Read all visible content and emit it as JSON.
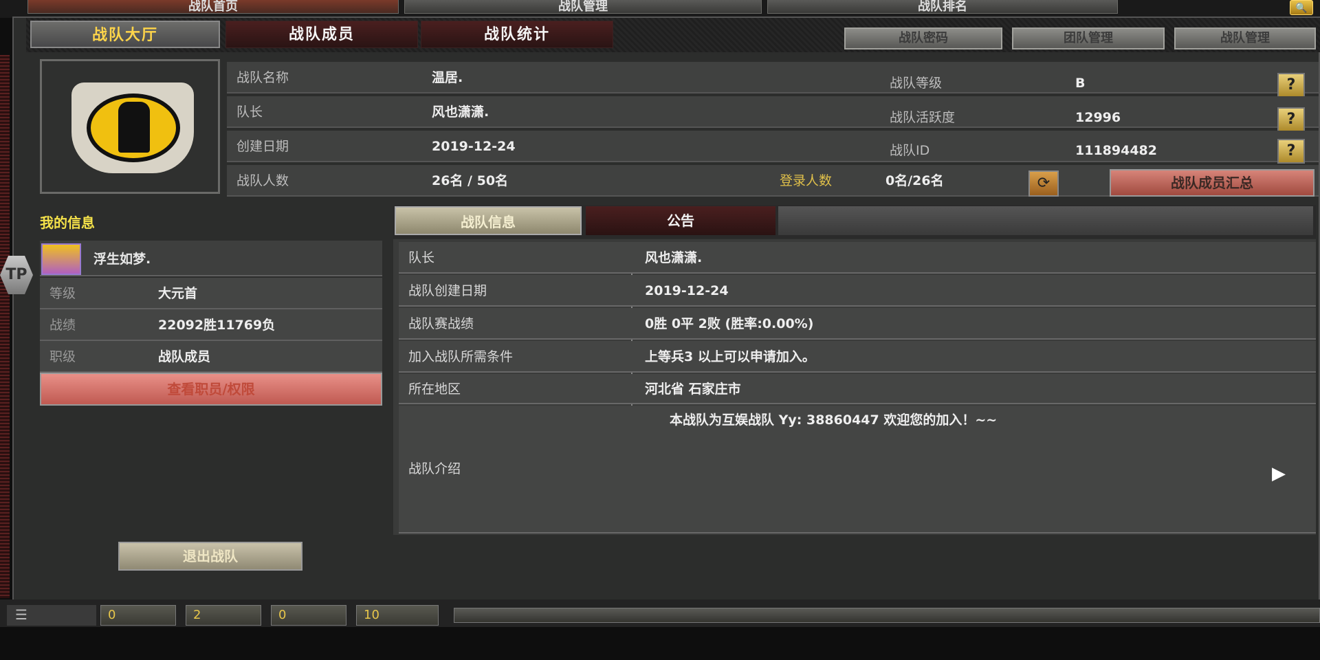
{
  "top_tabs": [
    "战队首页",
    "战队管理",
    "战队排名"
  ],
  "sub_nav": {
    "tabs": [
      "战队大厅",
      "战队成员",
      "战队统计"
    ],
    "right_buttons": [
      "战队密码",
      "团队管理",
      "战队管理"
    ]
  },
  "clan": {
    "name_label": "战队名称",
    "name": "温居.",
    "leader_label": "队长",
    "leader": "风也潇潇.",
    "created_label": "创建日期",
    "created": "2019-12-24",
    "members_label": "战队人数",
    "members": "26名 / 50名",
    "level_label": "战队等级",
    "level": "B",
    "activity_label": "战队活跃度",
    "activity": "12996",
    "id_label": "战队ID",
    "id": "111894482",
    "online_label": "登录人数",
    "online": "0名/26名",
    "member_summary_button": "战队成员汇总",
    "help_glyph": "?"
  },
  "my_info": {
    "heading": "我的信息",
    "nickname": "浮生如梦.",
    "rank_label": "等级",
    "rank": "大元首",
    "record_label": "战绩",
    "record": "22092胜11769负",
    "position_label": "职级",
    "position": "战队成员",
    "view_button": "查看职员/权限",
    "leave_button": "退出战队"
  },
  "detail_tabs": [
    "战队信息",
    "公告"
  ],
  "detail": {
    "leader_label": "队长",
    "leader": "风也潇潇.",
    "created_label": "战队创建日期",
    "created": "2019-12-24",
    "match_label": "战队赛战绩",
    "match": "0胜 0平 2败 (胜率:0.00%)",
    "join_label": "加入战队所需条件",
    "join": "上等兵3 以上可以申请加入。",
    "region_label": "所在地区",
    "region": "河北省 石家庄市",
    "intro_label": "战队介绍",
    "intro": "本战队为互娱战队  Yy: 38860447  欢迎您的加入！~~"
  },
  "status_bar": {
    "gold": "0",
    "medal": "2",
    "chat": "0",
    "volume": "10"
  },
  "side_badge": "TP"
}
